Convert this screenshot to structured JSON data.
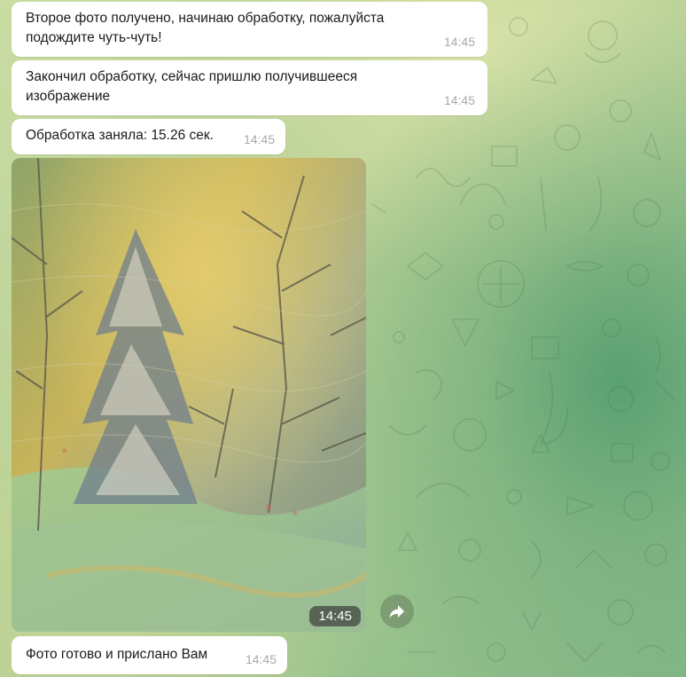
{
  "messages": [
    {
      "text": "Второе фото получено, начинаю обработку, пожалуйста\nподождите чуть-чуть!",
      "time": "14:45"
    },
    {
      "text": "Закончил обработку, сейчас пришлю получившееся\nизображение",
      "time": "14:45"
    },
    {
      "text": "Обработка заняла: 15.26 сек.",
      "time": "14:45"
    },
    {
      "type": "photo",
      "time": "14:45"
    },
    {
      "text": "Фото готово и прислано Вам",
      "time": "14:45"
    }
  ],
  "share_icon": "forward-arrow-icon",
  "colors": {
    "bubble": "#ffffff",
    "time": "#a4a9ae",
    "share_button": "#789670"
  }
}
